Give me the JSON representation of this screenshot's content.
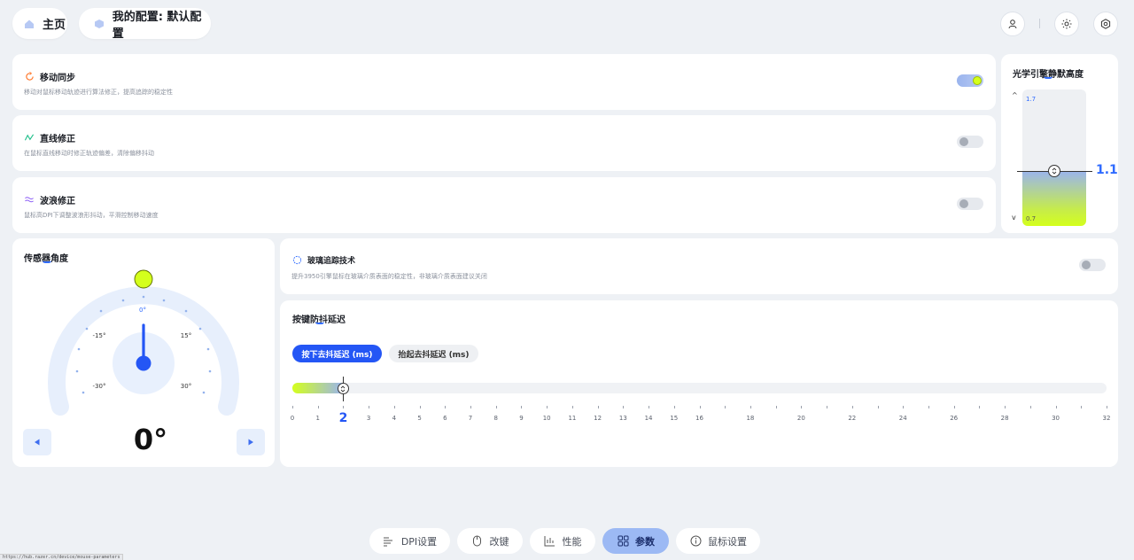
{
  "header": {
    "home_label": "主页",
    "config_label": "我的配置: 默认配置"
  },
  "features": {
    "motion_sync": {
      "title": "移动同步",
      "desc": "移动对鼠标移动轨迹进行算法修正，提高追踪的稳定性",
      "enabled": true
    },
    "straight_line": {
      "title": "直线修正",
      "desc": "在鼠标直线移动时修正轨迹偏差，清除偏移抖动",
      "enabled": false
    },
    "ripple": {
      "title": "波浪修正",
      "desc": "鼠标高DPI下调整波浪形抖动，平滑控制移动速度",
      "enabled": false
    },
    "glass": {
      "title": "玻璃追踪技术",
      "desc": "提升3950引擎鼠标在玻璃介质表面的稳定性，非玻璃介质表面建议关闭",
      "enabled": false
    }
  },
  "lod": {
    "title": "光学引擎静默高度",
    "max_label": "1.7",
    "min_label": "0.7",
    "value": "1.1",
    "value_num": 1.1,
    "range": [
      0.7,
      1.7
    ],
    "up_arrow": "^",
    "down_arrow": "v"
  },
  "sensor": {
    "title": "传感器角度",
    "labels": {
      "zero": "0°",
      "neg15": "-15°",
      "pos15": "15°",
      "neg30": "-30°",
      "pos30": "30°"
    },
    "value": "0°",
    "angle": 0
  },
  "debounce": {
    "title": "按键防抖延迟",
    "tab_press": "按下去抖延迟 (ms)",
    "tab_release": "抬起去抖延迟 (ms)",
    "value": 2,
    "value_label": "2",
    "range": [
      0,
      32
    ],
    "tick_labels": [
      "0",
      "1",
      "3",
      "4",
      "5",
      "6",
      "7",
      "8",
      "9",
      "10",
      "11",
      "12",
      "13",
      "14",
      "15",
      "16",
      "18",
      "20",
      "22",
      "24",
      "26",
      "28",
      "30",
      "32"
    ]
  },
  "nav": {
    "dpi": "DPI设置",
    "keys": "改键",
    "perf": "性能",
    "params": "参数",
    "mouse": "鼠标设置"
  },
  "status_url": "https://hub.razer.cn/device/mouse-parameters",
  "colors": {
    "accent": "#2f6bff",
    "lime": "#d4ff1c",
    "nav_active": "#9cb9f4"
  }
}
